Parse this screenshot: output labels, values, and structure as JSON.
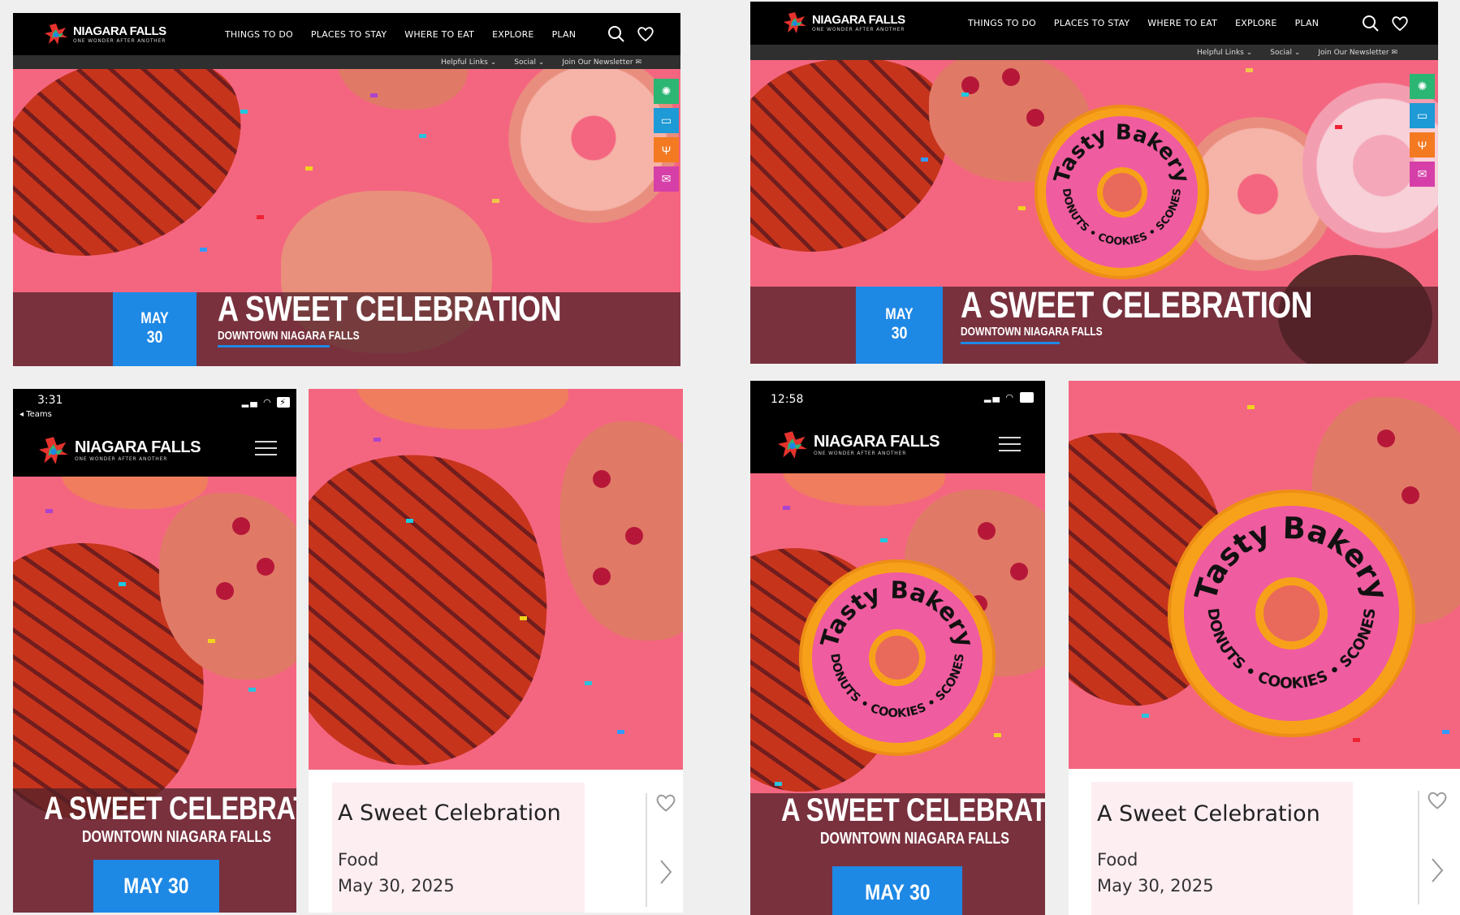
{
  "brand": {
    "name": "NIAGARA FALLS",
    "tagline": "ONE WONDER AFTER ANOTHER"
  },
  "nav": {
    "items": [
      "THINGS TO DO",
      "PLACES TO STAY",
      "WHERE TO EAT",
      "EXPLORE",
      "PLAN"
    ]
  },
  "subnav": {
    "helpful_links": "Helpful Links",
    "social": "Social",
    "newsletter": "Join Our Newsletter"
  },
  "event": {
    "title": "A SWEET CELEBRATION",
    "location": "DOWNTOWN NIAGARA FALLS",
    "month": "MAY",
    "day": "30",
    "date_inline": "MAY 30"
  },
  "badge": {
    "name": "Tasty Bakery",
    "items": "DONUTS • COOKIES • SCONES"
  },
  "phone_a": {
    "time": "3:31",
    "back_app": "◂ Teams"
  },
  "phone_b": {
    "time": "12:58"
  },
  "card": {
    "title": "A Sweet Celebration",
    "category": "Food",
    "date": "May 30, 2025"
  },
  "icons": {
    "search": "search-icon",
    "favorite": "heart-icon",
    "menu": "hamburger-menu-icon"
  },
  "colors": {
    "accent_blue": "#1e88e5",
    "hero_pink": "#f46680",
    "header_black": "#000000"
  }
}
